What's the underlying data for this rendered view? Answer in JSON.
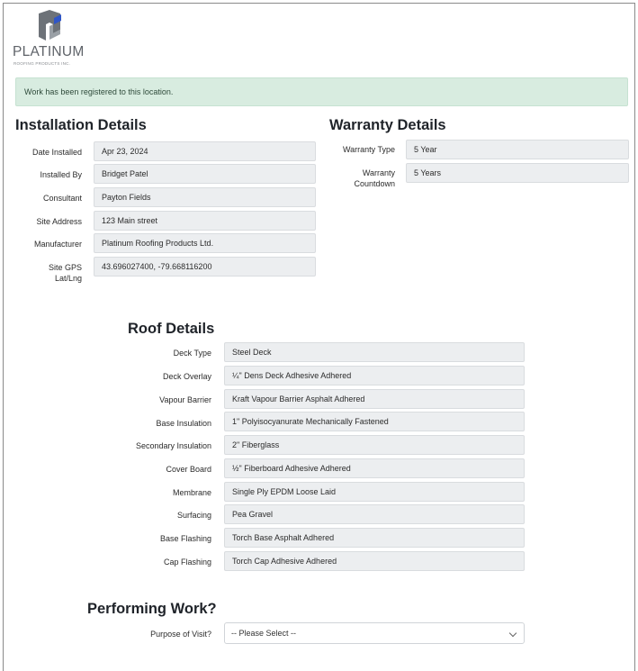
{
  "brand": {
    "name": "PLATINUM",
    "sub": "ROOFING PRODUCTS INC."
  },
  "alert": {
    "message": "Work has been registered to this location."
  },
  "installation": {
    "title": "Installation Details",
    "rows": [
      {
        "label": "Date Installed",
        "value": "Apr 23, 2024"
      },
      {
        "label": "Installed By",
        "value": "Bridget Patel"
      },
      {
        "label": "Consultant",
        "value": "Payton Fields"
      },
      {
        "label": "Site Address",
        "value": "123 Main street"
      },
      {
        "label": "Manufacturer",
        "value": "Platinum Roofing Products Ltd."
      },
      {
        "label": "Site GPS Lat/Lng",
        "value": "43.696027400, -79.668116200"
      }
    ]
  },
  "warranty": {
    "title": "Warranty Details",
    "rows": [
      {
        "label": "Warranty Type",
        "value": "5 Year"
      },
      {
        "label": "Warranty Countdown",
        "value": "5 Years"
      }
    ]
  },
  "roof": {
    "title": "Roof Details",
    "rows": [
      {
        "label": "Deck Type",
        "value": "Steel Deck"
      },
      {
        "label": "Deck Overlay",
        "value": "¼\" Dens Deck Adhesive Adhered"
      },
      {
        "label": "Vapour Barrier",
        "value": "Kraft Vapour Barrier Asphalt Adhered"
      },
      {
        "label": "Base Insulation",
        "value": "1\" Polyisocyanurate Mechanically Fastened"
      },
      {
        "label": "Secondary Insulation",
        "value": "2\" Fiberglass"
      },
      {
        "label": "Cover Board",
        "value": "½\" Fiberboard Adhesive Adhered"
      },
      {
        "label": "Membrane",
        "value": "Single Ply EPDM Loose Laid"
      },
      {
        "label": "Surfacing",
        "value": "Pea Gravel"
      },
      {
        "label": "Base Flashing",
        "value": "Torch Base Asphalt Adhered"
      },
      {
        "label": "Cap Flashing",
        "value": "Torch Cap Adhesive Adhered"
      }
    ]
  },
  "work": {
    "title": "Performing Work?",
    "purpose_label": "Purpose of Visit?",
    "purpose_value": "-- Please Select --"
  },
  "colors": {
    "alert_bg": "#d8ece0",
    "field_bg": "#eceef0",
    "logo_blue": "#2f56c8"
  }
}
